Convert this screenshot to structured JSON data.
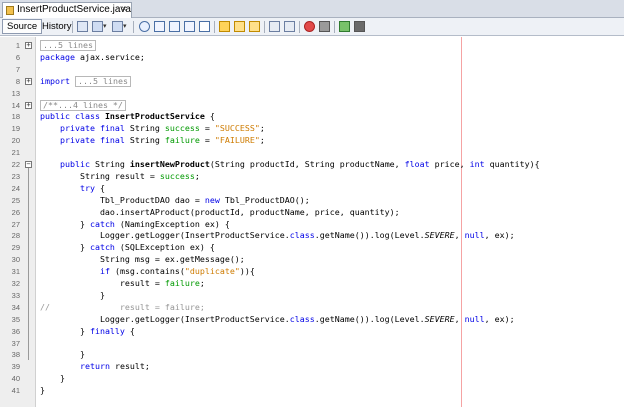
{
  "tab": {
    "title": "InsertProductService.java",
    "close": "×"
  },
  "toolbar": {
    "source_label": "Source",
    "history_label": "History"
  },
  "lines": [
    {
      "n": "1",
      "fold": "+",
      "parts": [
        {
          "t": "...5 lines",
          "c": "collapsed"
        }
      ]
    },
    {
      "n": "6",
      "parts": [
        {
          "t": "package",
          "c": "kw"
        },
        {
          "t": " ajax.service;"
        }
      ]
    },
    {
      "n": "7",
      "parts": []
    },
    {
      "n": "8",
      "fold": "+",
      "parts": [
        {
          "t": "import",
          "c": "kw"
        },
        {
          "t": " "
        },
        {
          "t": "...5 lines",
          "c": "collapsed"
        }
      ]
    },
    {
      "n": "13",
      "parts": []
    },
    {
      "n": "14",
      "fold": "+",
      "parts": [
        {
          "t": "/**...4 lines */",
          "c": "collapsed"
        }
      ]
    },
    {
      "n": "18",
      "parts": [
        {
          "t": "public class ",
          "c": "kw"
        },
        {
          "t": "InsertProductService",
          "c": "bold"
        },
        {
          "t": " {"
        }
      ]
    },
    {
      "n": "19",
      "parts": [
        {
          "t": "    "
        },
        {
          "t": "private final ",
          "c": "kw"
        },
        {
          "t": "String "
        },
        {
          "t": "success",
          "c": "fld"
        },
        {
          "t": " = "
        },
        {
          "t": "\"SUCCESS\"",
          "c": "str"
        },
        {
          "t": ";"
        }
      ]
    },
    {
      "n": "20",
      "parts": [
        {
          "t": "    "
        },
        {
          "t": "private final ",
          "c": "kw"
        },
        {
          "t": "String "
        },
        {
          "t": "failure",
          "c": "fld"
        },
        {
          "t": " = "
        },
        {
          "t": "\"FAILURE\"",
          "c": "str"
        },
        {
          "t": ";"
        }
      ]
    },
    {
      "n": "21",
      "parts": []
    },
    {
      "n": "22",
      "fold": "−",
      "parts": [
        {
          "t": "    "
        },
        {
          "t": "public ",
          "c": "kw"
        },
        {
          "t": "String "
        },
        {
          "t": "insertNewProduct",
          "c": "bold"
        },
        {
          "t": "(String productId, String productName, "
        },
        {
          "t": "float",
          "c": "kw"
        },
        {
          "t": " price, "
        },
        {
          "t": "int",
          "c": "kw"
        },
        {
          "t": " quantity){"
        }
      ]
    },
    {
      "n": "23",
      "parts": [
        {
          "t": "        String result = "
        },
        {
          "t": "success",
          "c": "fld"
        },
        {
          "t": ";"
        }
      ]
    },
    {
      "n": "24",
      "parts": [
        {
          "t": "        "
        },
        {
          "t": "try",
          "c": "kw"
        },
        {
          "t": " {"
        }
      ]
    },
    {
      "n": "25",
      "parts": [
        {
          "t": "            Tbl_ProductDAO dao = "
        },
        {
          "t": "new",
          "c": "kw"
        },
        {
          "t": " Tbl_ProductDAO();"
        }
      ]
    },
    {
      "n": "26",
      "parts": [
        {
          "t": "            dao.insertAProduct(productId, productName, price, quantity);"
        }
      ]
    },
    {
      "n": "27",
      "parts": [
        {
          "t": "        } "
        },
        {
          "t": "catch",
          "c": "kw"
        },
        {
          "t": " (NamingException ex) {"
        }
      ]
    },
    {
      "n": "28",
      "parts": [
        {
          "t": "            Logger.getLogger(InsertProductService."
        },
        {
          "t": "class",
          "c": "kw"
        },
        {
          "t": ".getName()).log(Level."
        },
        {
          "t": "SEVERE",
          "c": "fld ital"
        },
        {
          "t": ", "
        },
        {
          "t": "null",
          "c": "kw"
        },
        {
          "t": ", ex);"
        }
      ]
    },
    {
      "n": "29",
      "parts": [
        {
          "t": "        } "
        },
        {
          "t": "catch",
          "c": "kw"
        },
        {
          "t": " (SQLException ex) {"
        }
      ]
    },
    {
      "n": "30",
      "parts": [
        {
          "t": "            String msg = ex.getMessage();"
        }
      ]
    },
    {
      "n": "31",
      "parts": [
        {
          "t": "            "
        },
        {
          "t": "if",
          "c": "kw"
        },
        {
          "t": " (msg.contains("
        },
        {
          "t": "\"duplicate\"",
          "c": "str"
        },
        {
          "t": ")){"
        }
      ]
    },
    {
      "n": "32",
      "parts": [
        {
          "t": "                result = "
        },
        {
          "t": "failure",
          "c": "fld"
        },
        {
          "t": ";"
        }
      ]
    },
    {
      "n": "33",
      "parts": [
        {
          "t": "            }"
        }
      ]
    },
    {
      "n": "34",
      "parts": [
        {
          "t": "//              result = failure;",
          "c": "cmt"
        }
      ]
    },
    {
      "n": "35",
      "parts": [
        {
          "t": "            Logger.getLogger(InsertProductService."
        },
        {
          "t": "class",
          "c": "kw"
        },
        {
          "t": ".getName()).log(Level."
        },
        {
          "t": "SEVERE",
          "c": "fld ital"
        },
        {
          "t": ", "
        },
        {
          "t": "null",
          "c": "kw"
        },
        {
          "t": ", ex);"
        }
      ]
    },
    {
      "n": "36",
      "parts": [
        {
          "t": "        } "
        },
        {
          "t": "finally",
          "c": "kw"
        },
        {
          "t": " {"
        }
      ]
    },
    {
      "n": "37",
      "parts": []
    },
    {
      "n": "38",
      "parts": [
        {
          "t": "        }"
        }
      ]
    },
    {
      "n": "39",
      "parts": [
        {
          "t": "        "
        },
        {
          "t": "return",
          "c": "kw"
        },
        {
          "t": " result;"
        }
      ]
    },
    {
      "n": "40",
      "parts": [
        {
          "t": "    }"
        }
      ]
    },
    {
      "n": "41",
      "parts": [
        {
          "t": "}"
        }
      ]
    }
  ]
}
